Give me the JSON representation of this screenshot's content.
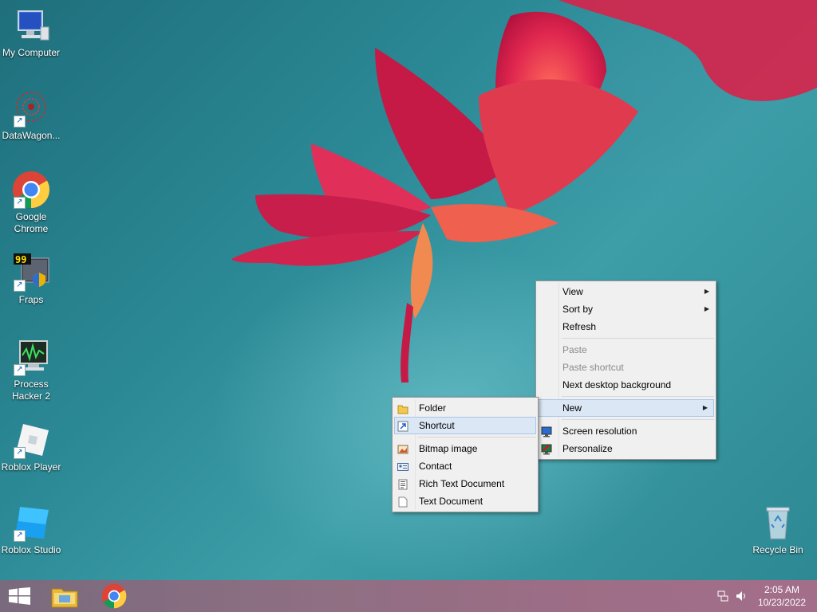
{
  "desktop": {
    "icons": [
      {
        "label": "My Computer"
      },
      {
        "label": "DataWagon..."
      },
      {
        "label": "Google Chrome"
      },
      {
        "label": "Fraps"
      },
      {
        "label": "Process Hacker 2"
      },
      {
        "label": "Roblox Player"
      },
      {
        "label": "Roblox Studio"
      },
      {
        "label": "Recycle Bin"
      }
    ]
  },
  "context_menu": {
    "items": [
      {
        "label": "View",
        "has_submenu": true
      },
      {
        "label": "Sort by",
        "has_submenu": true
      },
      {
        "label": "Refresh"
      },
      {
        "label": "Paste",
        "disabled": true
      },
      {
        "label": "Paste shortcut",
        "disabled": true
      },
      {
        "label": "Next desktop background"
      },
      {
        "label": "New",
        "has_submenu": true,
        "highlighted": true
      },
      {
        "label": "Screen resolution",
        "icon": "display-icon"
      },
      {
        "label": "Personalize",
        "icon": "personalize-icon"
      }
    ]
  },
  "new_submenu": {
    "items": [
      {
        "label": "Folder",
        "icon": "folder-icon"
      },
      {
        "label": "Shortcut",
        "icon": "shortcut-icon",
        "highlighted": true
      },
      {
        "label": "Bitmap image",
        "icon": "bitmap-icon"
      },
      {
        "label": "Contact",
        "icon": "contact-icon"
      },
      {
        "label": "Rich Text Document",
        "icon": "rtf-icon"
      },
      {
        "label": "Text Document",
        "icon": "text-document-icon"
      }
    ]
  },
  "taskbar": {
    "start": "start-icon",
    "pinned": [
      "file-explorer-icon",
      "chrome-icon"
    ],
    "clock": {
      "time": "2:05 AM",
      "date": "10/23/2022"
    }
  }
}
